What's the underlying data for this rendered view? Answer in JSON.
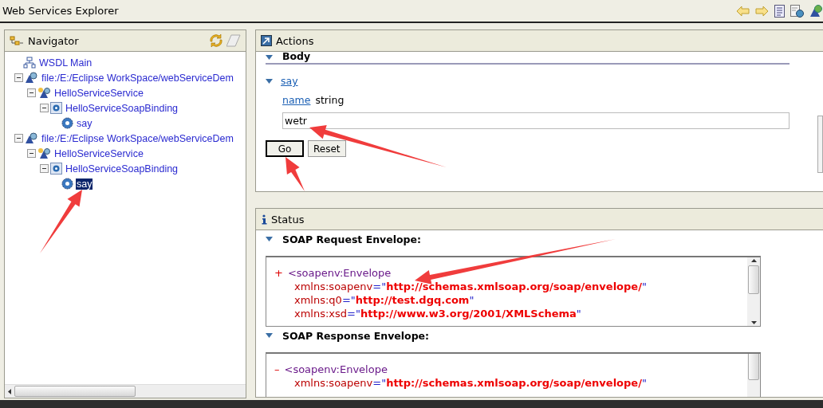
{
  "window": {
    "title": "Web Services Explorer"
  },
  "toolbar": [
    {
      "kind": "back"
    },
    {
      "kind": "forward"
    },
    {
      "kind": "document"
    },
    {
      "kind": "globe-page"
    },
    {
      "kind": "wsdl"
    }
  ],
  "navigator": {
    "title": "Navigator",
    "tree": [
      {
        "label": "WSDL Main",
        "kind": "main",
        "selected": false
      },
      {
        "label": "file:/E:/Eclipse WorkSpace/webServiceDem",
        "kind": "wsdl",
        "selected": false,
        "expanded": true,
        "children": [
          {
            "label": "HelloServiceService",
            "kind": "service",
            "selected": false,
            "expanded": true,
            "children": [
              {
                "label": "HelloServiceSoapBinding",
                "kind": "binding",
                "selected": false,
                "expanded": true,
                "children": [
                  {
                    "label": "say",
                    "kind": "operation",
                    "selected": false
                  }
                ]
              }
            ]
          }
        ]
      },
      {
        "label": "file:/E:/Eclipse WorkSpace/webServiceDem",
        "kind": "wsdl",
        "selected": false,
        "expanded": true,
        "children": [
          {
            "label": "HelloServiceService",
            "kind": "service",
            "selected": false,
            "expanded": true,
            "children": [
              {
                "label": "HelloServiceSoapBinding",
                "kind": "binding",
                "selected": false,
                "expanded": true,
                "children": [
                  {
                    "label": "say",
                    "kind": "operation",
                    "selected": true
                  }
                ]
              }
            ]
          }
        ]
      }
    ]
  },
  "actions": {
    "title": "Actions",
    "section": "Body",
    "operation": "say",
    "param_name": "name",
    "param_type": "string",
    "value": "wetr",
    "buttons": [
      {
        "label": "Go",
        "kind": "default"
      },
      {
        "label": "Reset",
        "kind": "normal"
      }
    ]
  },
  "status": {
    "title": "Status",
    "sections": [
      {
        "title": "SOAP Request Envelope:",
        "lines": [
          {
            "kind": "tag",
            "marker": "+",
            "text": "<soapenv:Envelope"
          },
          {
            "kind": "attr",
            "name": "xmlns:soapenv",
            "eq": "=\"",
            "value": "http://schemas.xmlsoap.org/soap/envelope/",
            "close": "\""
          },
          {
            "kind": "attr",
            "name": "xmlns:q0",
            "eq": "=\"",
            "value": "http://test.dgq.com",
            "close": "\""
          },
          {
            "kind": "attr",
            "name": "xmlns:xsd",
            "eq": "=\"",
            "value": "http://www.w3.org/2001/XMLSchema",
            "close": "\""
          }
        ]
      },
      {
        "title": "SOAP Response Envelope:",
        "lines": [
          {
            "kind": "tag",
            "marker": "–",
            "text": "<soapenv:Envelope"
          },
          {
            "kind": "attr",
            "name": "xmlns:soapenv",
            "eq": "=\"",
            "value": "http://schemas.xmlsoap.org/soap/envelope/",
            "close": "\""
          }
        ]
      }
    ]
  },
  "annotations": [
    {
      "kind": "arrow"
    },
    {
      "kind": "arrow"
    },
    {
      "kind": "arrow"
    },
    {
      "kind": "arrow"
    }
  ]
}
